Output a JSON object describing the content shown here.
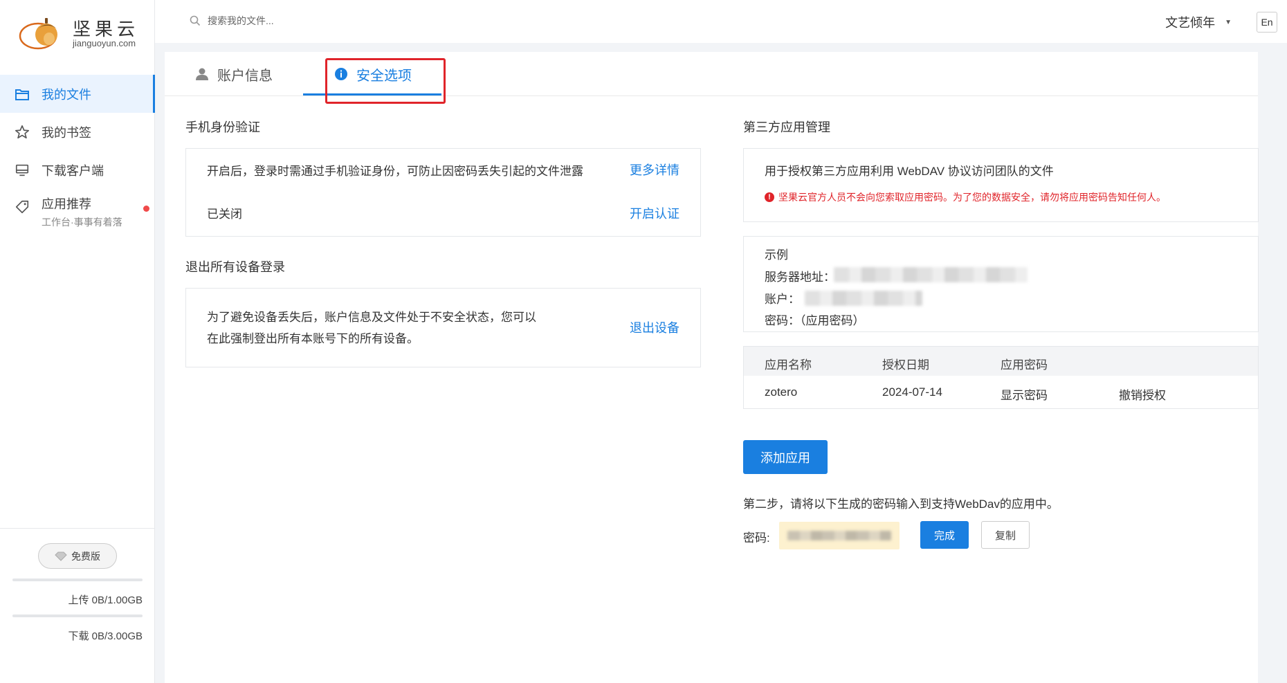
{
  "brand": {
    "name": "坚果云",
    "domain": "jianguoyun.com"
  },
  "sidebar": {
    "items": [
      {
        "label": "我的文件",
        "icon": "folder-icon",
        "active": true
      },
      {
        "label": "我的书签",
        "icon": "star-icon",
        "active": false
      },
      {
        "label": "下载客户端",
        "icon": "monitor-icon",
        "active": false
      },
      {
        "label": "应用推荐",
        "sub": "工作台·事事有着落",
        "icon": "tag-icon",
        "active": false,
        "badge": true
      }
    ],
    "plan_label": "免费版",
    "upload_quota": "上传 0B/1.00GB",
    "download_quota": "下载 0B/3.00GB",
    "upload_fraction": 0,
    "download_fraction": 0
  },
  "topbar": {
    "search_placeholder": "搜索我的文件...",
    "user_name": "文艺倾年",
    "lang_toggle": "En"
  },
  "tabs": [
    {
      "label": "账户信息",
      "icon": "user-icon",
      "active": false
    },
    {
      "label": "安全选项",
      "icon": "info-icon",
      "active": true
    }
  ],
  "phone_auth": {
    "title": "手机身份验证",
    "description": "开启后，登录时需通过手机验证身份，可防止因密码丢失引起的文件泄露",
    "more_link": "更多详情",
    "status": "已关闭",
    "enable_link": "开启认证"
  },
  "logout_all": {
    "title": "退出所有设备登录",
    "description_line1": "为了避免设备丢失后，账户信息及文件处于不安全状态，您可以",
    "description_line2": "在此强制登出所有本账号下的所有设备。",
    "action_link": "退出设备"
  },
  "third_party": {
    "title": "第三方应用管理",
    "description": "用于授权第三方应用利用 WebDAV 协议访问团队的文件",
    "warning": "坚果云官方人员不会向您索取应用密码。为了您的数据安全，请勿将应用密码告知任何人。",
    "example_title": "示例",
    "server_label": "服务器地址：",
    "account_label": "账户：",
    "password_label": "密码：（应用密码）",
    "table": {
      "headers": [
        "应用名称",
        "授权日期",
        "应用密码"
      ],
      "rows": [
        {
          "name": "zotero",
          "date": "2024-07-14",
          "show": "显示密码",
          "revoke": "撤销授权"
        }
      ]
    },
    "add_button": "添加应用",
    "step_text": "第二步，请将以下生成的密码输入到支持WebDav的应用中。",
    "pwd_label": "密码:",
    "done_button": "完成",
    "copy_button": "复制"
  },
  "colors": {
    "accent": "#1a7fe0",
    "highlight": "#e0242a",
    "warning": "#e0242a"
  }
}
